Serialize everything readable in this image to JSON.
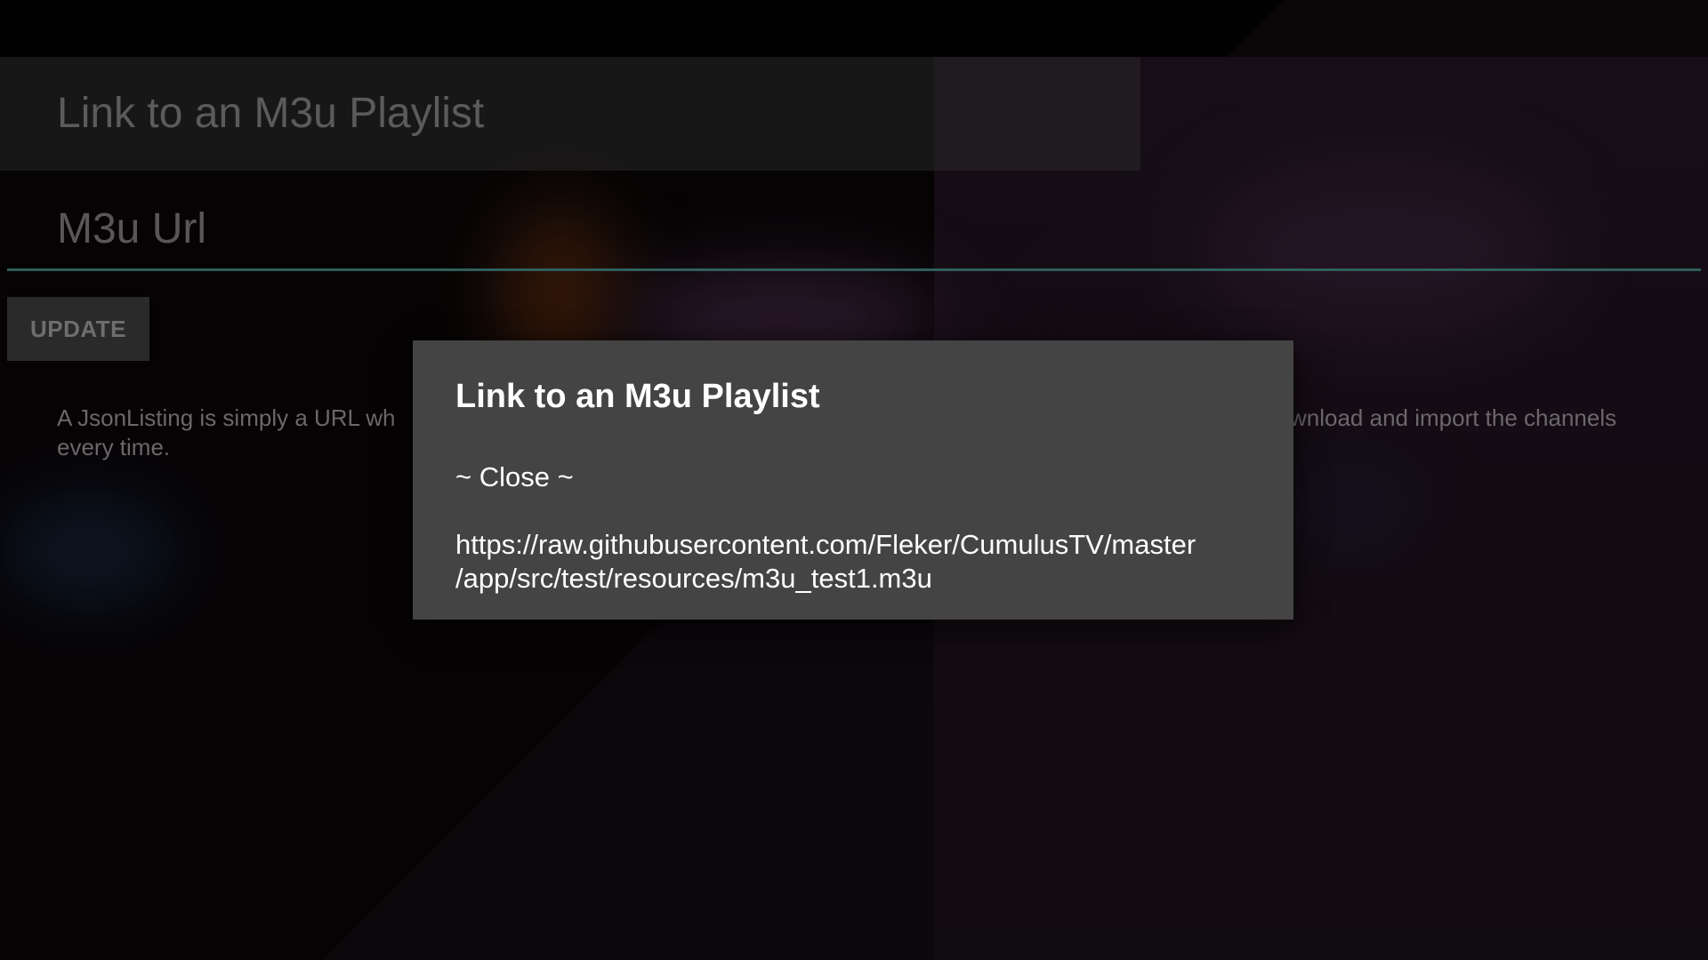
{
  "page": {
    "title": "Link to an M3u Playlist",
    "url_field_label": "M3u Url",
    "update_label": "UPDATE",
    "description_line1": "A JsonListing is simply a URL wh",
    "description_line1_end": "wnload and import the channels",
    "description_line2": "every time."
  },
  "dialog": {
    "title": "Link to an M3u Playlist",
    "close_label": "~ Close ~",
    "url_line1": "https://raw.githubusercontent.com/Fleker/CumulusTV/master",
    "url_line2": "/app/src/test/resources/m3u_test1.m3u"
  },
  "colors": {
    "dialog_background": "#444444",
    "accent_underline": "#2f5f5c",
    "page_background": "#0b0709"
  }
}
